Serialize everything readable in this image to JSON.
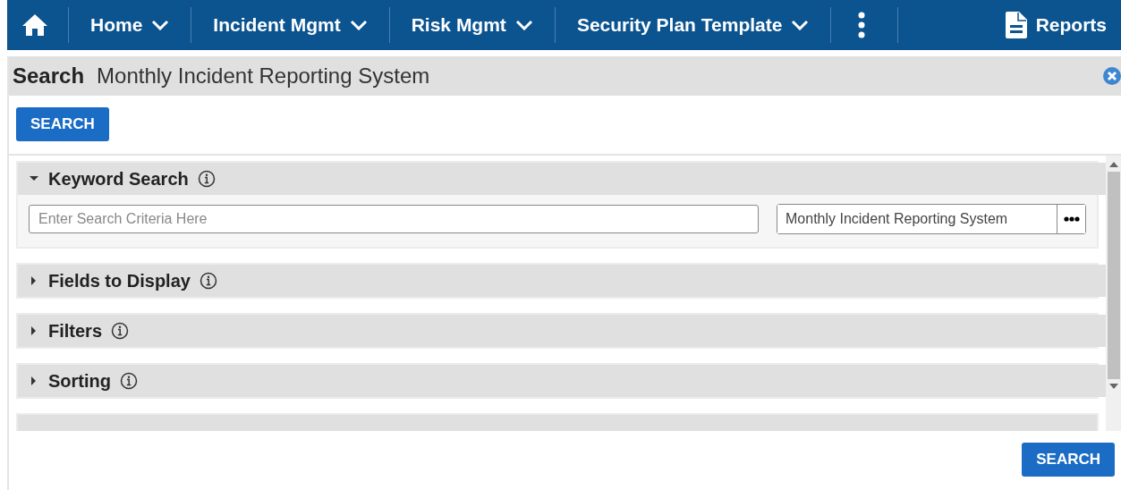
{
  "nav": [
    {
      "kind": "home"
    },
    {
      "kind": "menu",
      "label": "Home"
    },
    {
      "kind": "menu",
      "label": "Incident Mgmt"
    },
    {
      "kind": "menu",
      "label": "Risk Mgmt"
    },
    {
      "kind": "menu",
      "label": "Security Plan Template"
    },
    {
      "kind": "more"
    },
    {
      "kind": "reports",
      "label": "Reports"
    }
  ],
  "header": {
    "title": "Search",
    "subtitle": "Monthly Incident Reporting System"
  },
  "top_button": "SEARCH",
  "sections": [
    {
      "label": "Keyword Search",
      "expanded": true,
      "keyword": {
        "placeholder": "Enter Search Criteria Here"
      },
      "scope": {
        "value": "Monthly Incident Reporting System"
      }
    },
    {
      "label": "Fields to Display",
      "expanded": false
    },
    {
      "label": "Filters",
      "expanded": false
    },
    {
      "label": "Sorting",
      "expanded": false
    },
    {
      "expanded": false
    }
  ],
  "bottom_button": "SEARCH"
}
